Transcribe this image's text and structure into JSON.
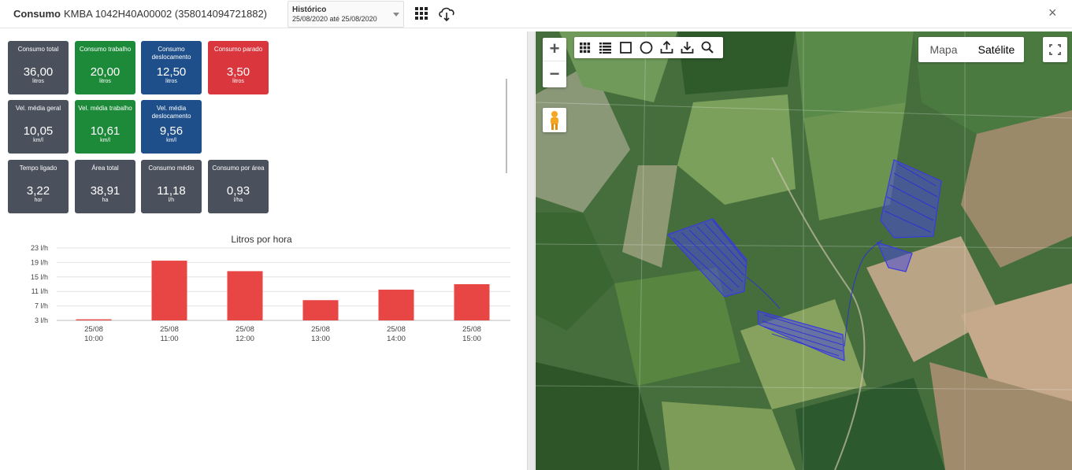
{
  "header": {
    "title_bold": "Consumo",
    "title_rest": "KMBA 1042H40A00002 (358014094721882)",
    "period_label": "Histórico",
    "period_value": "25/08/2020 até 25/08/2020",
    "grid_icon": "apps-grid-icon",
    "download_icon": "cloud-download-icon",
    "close_label": "×"
  },
  "cards": [
    {
      "label": "Consumo total",
      "value": "36,00",
      "unit": "litros",
      "color": "gray"
    },
    {
      "label": "Consumo trabalho",
      "value": "20,00",
      "unit": "litros",
      "color": "green"
    },
    {
      "label": "Consumo deslocamento",
      "value": "12,50",
      "unit": "litros",
      "color": "blue"
    },
    {
      "label": "Consumo parado",
      "value": "3,50",
      "unit": "litros",
      "color": "red"
    },
    {
      "label": "Vel. média geral",
      "value": "10,05",
      "unit": "km/l",
      "color": "gray"
    },
    {
      "label": "Vel. média trabalho",
      "value": "10,61",
      "unit": "km/l",
      "color": "green"
    },
    {
      "label": "Vel. média deslocamento",
      "value": "9,56",
      "unit": "km/l",
      "color": "blue"
    },
    {
      "label": "Tempo ligado",
      "value": "3,22",
      "unit": "hor",
      "color": "gray"
    },
    {
      "label": "Área total",
      "value": "38,91",
      "unit": "ha",
      "color": "gray"
    },
    {
      "label": "Consumo médio",
      "value": "11,18",
      "unit": "l/h",
      "color": "gray"
    },
    {
      "label": "Consumo por área",
      "value": "0,93",
      "unit": "l/ha",
      "color": "gray"
    }
  ],
  "colors": {
    "gray": "#4a505c",
    "green": "#1d8a3a",
    "blue": "#1e4f8a",
    "red": "#d9363e",
    "bar": "#e84545"
  },
  "chart_data": {
    "type": "bar",
    "title": "Litros por hora",
    "categories": [
      [
        "25/08",
        "10:00"
      ],
      [
        "25/08",
        "11:00"
      ],
      [
        "25/08",
        "12:00"
      ],
      [
        "25/08",
        "13:00"
      ],
      [
        "25/08",
        "14:00"
      ],
      [
        "25/08",
        "15:00"
      ]
    ],
    "values": [
      3.3,
      19.5,
      16.6,
      8.6,
      11.5,
      13.0
    ],
    "yticks": [
      "3 l/h",
      "7 l/h",
      "11 l/h",
      "15 l/h",
      "19 l/h",
      "23 l/h"
    ],
    "ytick_values": [
      3,
      7,
      11,
      15,
      19,
      23
    ],
    "ylim": [
      3,
      23
    ],
    "grid": true
  },
  "map": {
    "zoom_in": "+",
    "zoom_out": "−",
    "type_map": "Mapa",
    "type_satellite": "Satélite",
    "active_type": "Satélite",
    "tools": [
      "grid-icon",
      "list-icon",
      "rectangle-icon",
      "circle-icon",
      "upload-icon",
      "download-icon",
      "search-icon"
    ]
  }
}
